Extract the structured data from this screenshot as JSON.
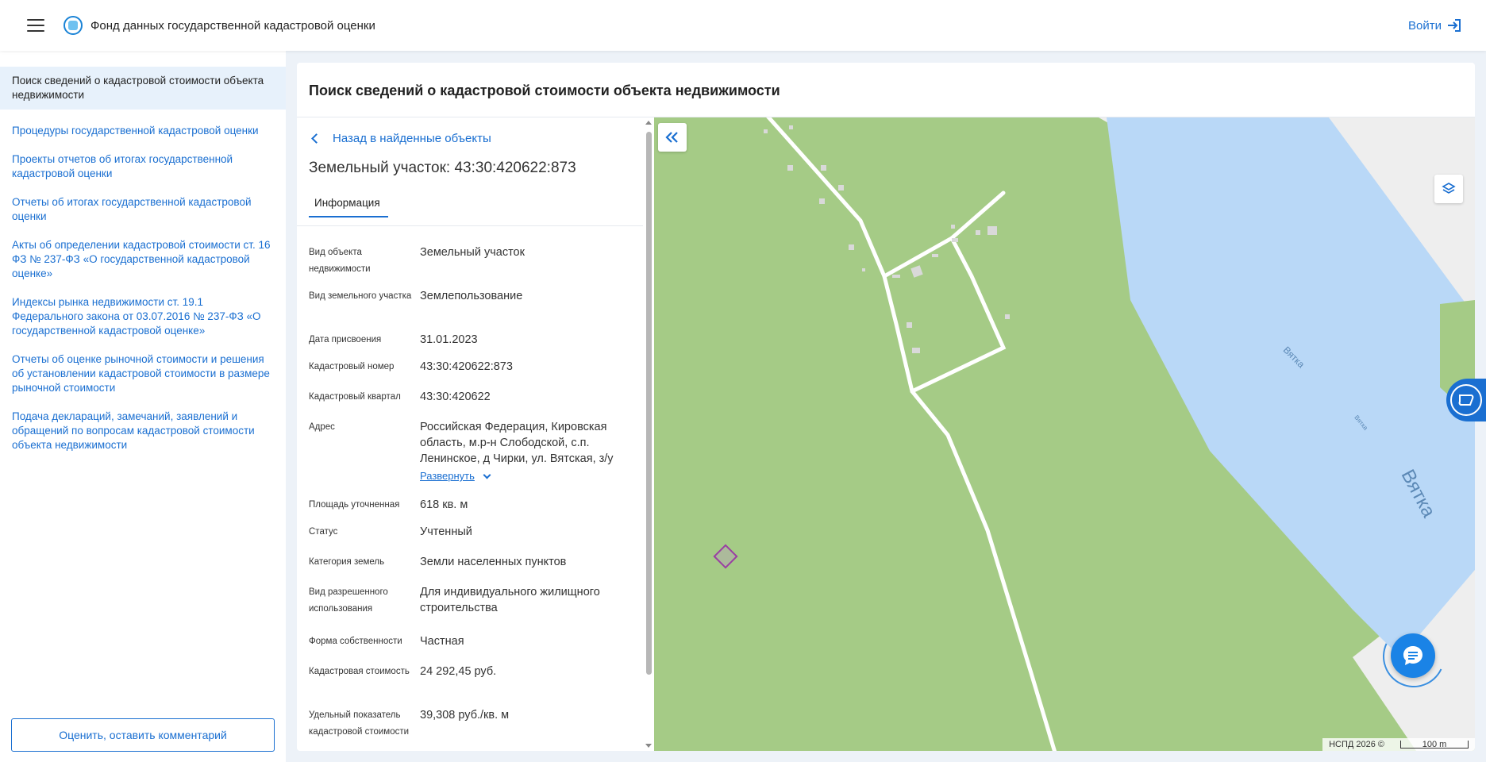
{
  "header": {
    "title": "Фонд данных государственной кадастровой оценки",
    "login_label": "Войти"
  },
  "sidebar": {
    "items": [
      {
        "label": "Поиск сведений о кадастровой стоимости объекта недвижимости",
        "active": true
      },
      {
        "label": "Процедуры государственной кадастровой оценки"
      },
      {
        "label": "Проекты отчетов об итогах государственной кадастровой оценки"
      },
      {
        "label": "Отчеты об итогах государственной кадастровой оценки"
      },
      {
        "label": "Акты об определении кадастровой стоимости ст. 16 ФЗ № 237-ФЗ «О государственной кадастровой оценке»"
      },
      {
        "label": "Индексы рынка недвижимости ст. 19.1 Федерального закона от 03.07.2016 № 237-ФЗ «О государственной кадастровой оценке»"
      },
      {
        "label": "Отчеты об оценке рыночной стоимости и решения об установлении кадастровой стоимости в размере рыночной стоимости"
      },
      {
        "label": "Подача деклараций, замечаний, заявлений и обращений по вопросам кадастровой стоимости объекта недвижимости"
      }
    ],
    "rate_button": "Оценить, оставить комментарий"
  },
  "main": {
    "title": "Поиск сведений о кадастровой стоимости объекта недвижимости",
    "back_label": "Назад в найденные объекты",
    "object_title": "Земельный участок: 43:30:420622:873",
    "tab_label": "Информация",
    "fields": [
      {
        "label": "Вид объекта недвижимости",
        "value": "Земельный участок"
      },
      {
        "label": "Вид земельного участка",
        "value": "Землепользование"
      },
      {
        "label": "Дата присвоения",
        "value": "31.01.2023"
      },
      {
        "label": "Кадастровый номер",
        "value": "43:30:420622:873"
      },
      {
        "label": "Кадастровый квартал",
        "value": "43:30:420622"
      },
      {
        "label": "Адрес",
        "value": "Российская Федерация, Кировская область, м.р-н Слободской, с.п. Ленинское, д Чирки, ул. Вятская, з/у"
      },
      {
        "label": "Площадь уточненная",
        "value": "618 кв. м"
      },
      {
        "label": "Статус",
        "value": "Учтенный"
      },
      {
        "label": "Категория земель",
        "value": "Земли населенных пунктов"
      },
      {
        "label": "Вид разрешенного использования",
        "value": "Для индивидуального жилищного строительства"
      },
      {
        "label": "Форма собственности",
        "value": "Частная"
      },
      {
        "label": "Кадастровая стоимость",
        "value": "24 292,45 руб."
      },
      {
        "label": "Удельный показатель кадастровой стоимости",
        "value": "39,308 руб./кв. м"
      }
    ],
    "expand_label": "Развернуть"
  },
  "map": {
    "river_labels": [
      "Вятка",
      "Вятка",
      "Вятка"
    ],
    "attribution": "НСПД 2026 ©",
    "scale_label": "100 m",
    "colors": {
      "land": "#a5cb86",
      "water": "#b9d8f7",
      "road": "#ffffff",
      "parcel": "#9a3fa2"
    }
  }
}
